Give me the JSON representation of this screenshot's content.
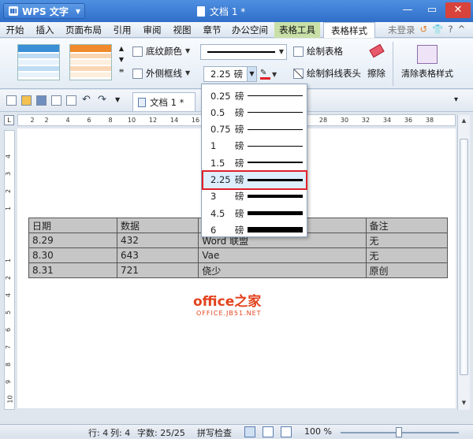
{
  "titlebar": {
    "app_name": "WPS 文字",
    "doc_title": "文档 1 *"
  },
  "menu": {
    "tabs": [
      "开始",
      "插入",
      "页面布局",
      "引用",
      "审阅",
      "视图",
      "章节",
      "办公空间"
    ],
    "context_tabs": [
      "表格工具",
      "表格样式"
    ],
    "login": "未登录"
  },
  "ribbon": {
    "shading_color": "底纹颜色",
    "outer_border": "外侧框线",
    "draw_table": "绘制表格",
    "draw_diagonal_header": "绘制斜线表头",
    "erase": "擦除",
    "clear_table_style": "清除表格样式",
    "line_weight_value": "2.25",
    "line_weight_unit": "磅"
  },
  "quick_access": {
    "doc_tab": "文档 1 *"
  },
  "ruler": {
    "h_ticks": [
      "2",
      "2",
      "4",
      "6",
      "8",
      "10",
      "12",
      "14",
      "16",
      "18",
      "20",
      "22",
      "24",
      "26",
      "28",
      "30",
      "32",
      "34",
      "36",
      "38",
      "40"
    ],
    "v_ticks": [
      "4",
      "3",
      "2",
      "1",
      "1",
      "2",
      "3",
      "4",
      "5",
      "6",
      "7",
      "8",
      "9",
      "10",
      "11",
      "12"
    ]
  },
  "line_weight_menu": {
    "unit": "磅",
    "items": [
      {
        "value": "0.25",
        "thickness": 1
      },
      {
        "value": "0.5",
        "thickness": 1
      },
      {
        "value": "0.75",
        "thickness": 1
      },
      {
        "value": "1",
        "thickness": 1
      },
      {
        "value": "1.5",
        "thickness": 2
      },
      {
        "value": "2.25",
        "thickness": 3
      },
      {
        "value": "3",
        "thickness": 4
      },
      {
        "value": "4.5",
        "thickness": 5
      },
      {
        "value": "6",
        "thickness": 7
      }
    ],
    "selected": "2.25"
  },
  "table": {
    "header": [
      "日期",
      "数据",
      "",
      "备注"
    ],
    "rows": [
      [
        "8.29",
        "432",
        "Word 联盟",
        "无"
      ],
      [
        "8.30",
        "643",
        "Vae",
        "无"
      ],
      [
        "8.31",
        "721",
        "侥少",
        "原创"
      ]
    ]
  },
  "watermark": {
    "main": "office之家",
    "sub": "OFFICE.JB51.NET"
  },
  "statusbar": {
    "col_label": "列: 4",
    "row_label": "行: 4",
    "chars": "字数: 25/25",
    "spellcheck": "拼写检查",
    "zoom": "100 %"
  }
}
